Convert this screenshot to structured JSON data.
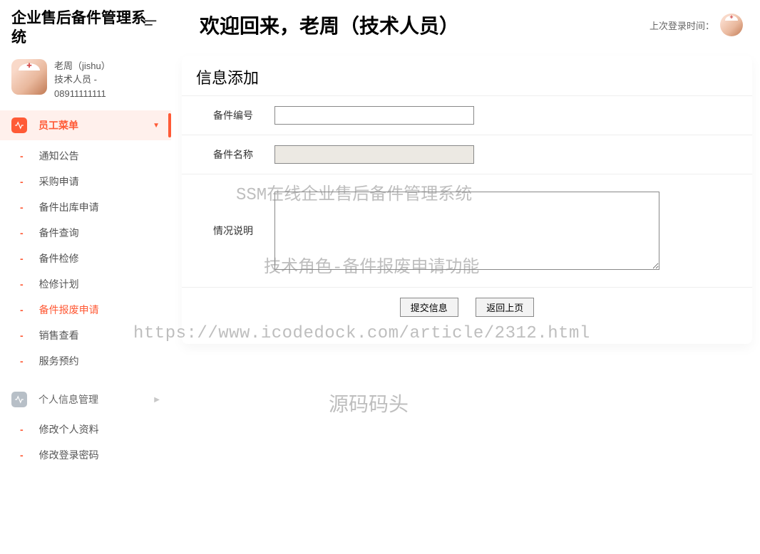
{
  "app": {
    "title": "企业售后备件管理系统"
  },
  "user": {
    "name_line": "老周（jishu）",
    "role_line": "技术人员 -",
    "phone": "08911111111"
  },
  "sidebar": {
    "group1_label": "员工菜单",
    "items": [
      {
        "label": "通知公告"
      },
      {
        "label": "采购申请"
      },
      {
        "label": "备件出库申请"
      },
      {
        "label": "备件查询"
      },
      {
        "label": "备件检修"
      },
      {
        "label": "检修计划"
      },
      {
        "label": "备件报废申请"
      },
      {
        "label": "销售查看"
      },
      {
        "label": "服务预约"
      }
    ],
    "group2_label": "个人信息管理",
    "items2": [
      {
        "label": "修改个人资料"
      },
      {
        "label": "修改登录密码"
      }
    ]
  },
  "header": {
    "welcome": "欢迎回来，老周（技术人员）",
    "last_login_label": "上次登录时间："
  },
  "form": {
    "title": "信息添加",
    "field1_label": "备件编号",
    "field1_value": "",
    "field2_label": "备件名称",
    "field2_value": "",
    "field3_label": "情况说明",
    "field3_value": "",
    "submit_label": "提交信息",
    "back_label": "返回上页"
  },
  "watermarks": {
    "line1": "SSM在线企业售后备件管理系统",
    "line2": "技术角色-备件报废申请功能",
    "line3": "https://www.icodedock.com/article/2312.html",
    "line4": "源码码头"
  }
}
